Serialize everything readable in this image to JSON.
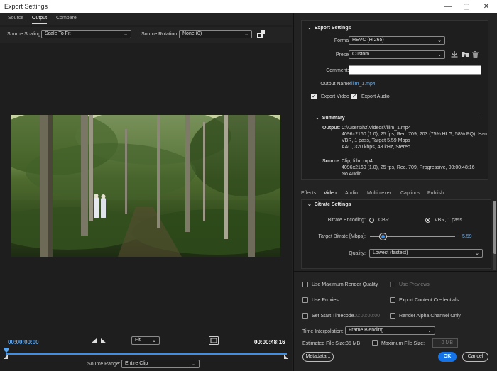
{
  "window": {
    "title": "Export Settings"
  },
  "tabs": [
    "Source",
    "Output",
    "Compare"
  ],
  "source_bar": {
    "scaling_label": "Source Scaling:",
    "scaling_value": "Scale To Fit",
    "rotation_label": "Source Rotation:",
    "rotation_value": "None (0)"
  },
  "transport": {
    "current_time": "00:00:00:00",
    "zoom_value": "Fit",
    "end_time": "00:00:48:16",
    "source_range_label": "Source Range:",
    "source_range_value": "Entire Clip"
  },
  "export_settings": {
    "header": "Export Settings",
    "format_label": "Format:",
    "format_value": "HEVC (H.265)",
    "preset_label": "Preset:",
    "preset_value": "Custom",
    "comments_label": "Comments:",
    "comments_value": "",
    "output_name_label": "Output Name:",
    "output_name_value": "fillm_1.mp4",
    "export_video_label": "Export Video",
    "export_audio_label": "Export Audio",
    "export_video_checked": true,
    "export_audio_checked": true
  },
  "summary": {
    "header": "Summary",
    "output_label": "Output:",
    "output_lines": [
      "C:\\Users\\hz\\Videos\\fillm_1.mp4",
      "4096x2160 (1.0), 25 fps, Rec. 709, 203 (75% HLG, 58% PQ), Hard...",
      "VBR, 1 pass, Target 5.59 Mbps",
      "AAC, 320 kbps, 48 kHz, Stereo"
    ],
    "source_label": "Source:",
    "source_lines": [
      "Clip, fillm.mp4",
      "4096x2160 (1.0), 25 fps, Rec. 709, Progressive, 00:00:48:16",
      "No Audio"
    ]
  },
  "sub_tabs": [
    "Effects",
    "Video",
    "Audio",
    "Multiplexer",
    "Captions",
    "Publish"
  ],
  "bitrate": {
    "header": "Bitrate Settings",
    "encoding_label": "Bitrate Encoding:",
    "cbr_label": "CBR",
    "vbr_label": "VBR, 1 pass",
    "selected": "VBR, 1 pass",
    "target_label": "Target Bitrate [Mbps]:",
    "target_value": "5.59",
    "slider_fraction": 0.15,
    "quality_label": "Quality:",
    "quality_value": "Lowest (fastest)"
  },
  "options": {
    "max_render_quality": "Use Maximum Render Quality",
    "use_previews": "Use Previews",
    "use_proxies": "Use Proxies",
    "content_credentials": "Export Content Credentials",
    "set_start_timecode": "Set Start Timecode",
    "start_timecode_value": "00:00:00:00",
    "render_alpha": "Render Alpha Channel Only",
    "interp_label": "Time Interpolation:",
    "interp_value": "Frame Blending",
    "est_size_label": "Estimated File Size:",
    "est_size_value": "35 MB",
    "max_file_size_label": "Maximum File Size:",
    "max_file_size_value": "0 MB"
  },
  "buttons": {
    "metadata": "Metadata...",
    "ok": "OK",
    "cancel": "Cancel"
  },
  "colors": {
    "accent": "#1473e6",
    "timecode_blue": "#5aa5f0",
    "link": "#6ab0f0"
  },
  "icons": [
    "minimize-icon",
    "maximize-icon",
    "close-icon",
    "chevron-down-icon",
    "aspect-ratio-icon",
    "mark-in-icon",
    "mark-out-icon",
    "safe-margins-icon",
    "playhead-icon",
    "save-preset-icon",
    "import-preset-icon",
    "delete-preset-icon"
  ]
}
